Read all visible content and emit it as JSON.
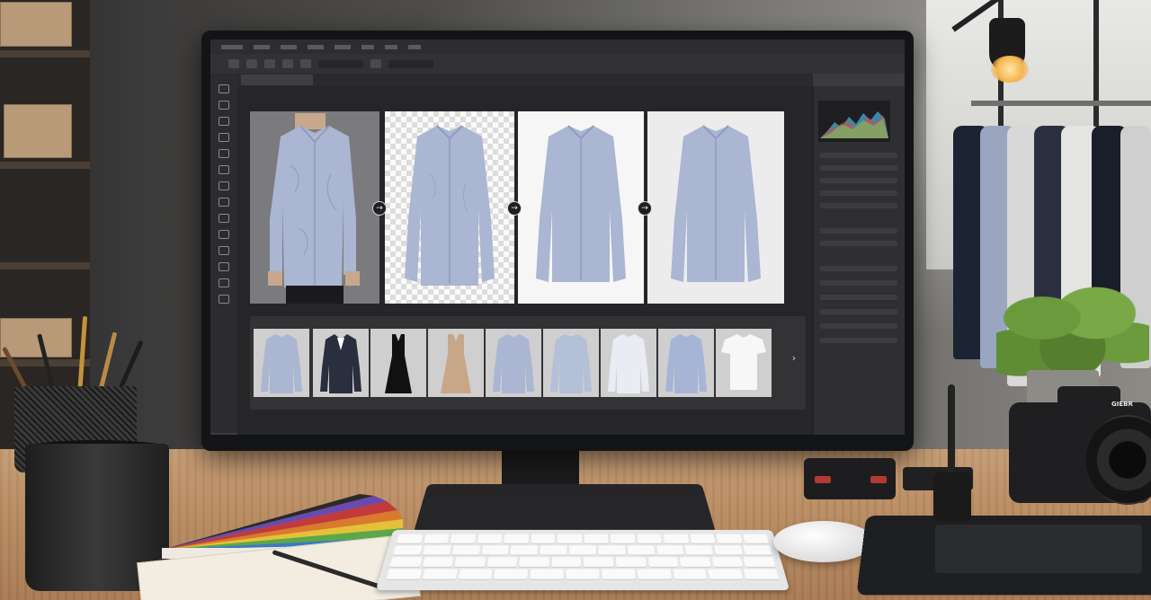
{
  "scene": {
    "description_free": true,
    "camera_brand": "GIEBR"
  },
  "editor": {
    "menu_items": [
      "",
      "",
      "",
      "",
      "",
      "",
      "",
      "",
      ""
    ],
    "stage_steps": [
      {
        "kind": "original",
        "background": "gray"
      },
      {
        "kind": "background-removed",
        "background": "transparent"
      },
      {
        "kind": "retouched",
        "background": "white"
      },
      {
        "kind": "final",
        "background": "white"
      }
    ],
    "filmstrip": [
      {
        "garment": "blue-shirt"
      },
      {
        "garment": "navy-suit"
      },
      {
        "garment": "black-dress"
      },
      {
        "garment": "beige-dress"
      },
      {
        "garment": "blue-shirt"
      },
      {
        "garment": "blue-shirt"
      },
      {
        "garment": "white-shirt"
      },
      {
        "garment": "blue-shirt"
      },
      {
        "garment": "white-tshirt"
      }
    ],
    "icons": {
      "arrow": "→",
      "next": "›"
    },
    "colors": {
      "shirt": "#aab6d2",
      "shirt_shadow": "#8f9cbd",
      "suit": "#2a2f3d",
      "black_dress": "#111111",
      "beige_dress": "#c8a789",
      "white_shirt": "#e9ecf2",
      "tshirt": "#f7f7f7"
    }
  }
}
